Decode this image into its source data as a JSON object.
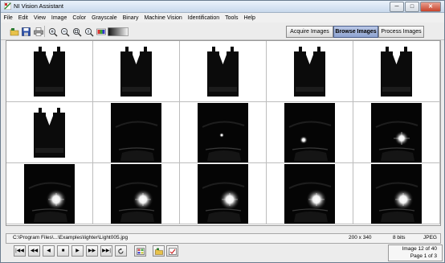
{
  "window": {
    "title": "NI Vision Assistant",
    "minimize": "─",
    "maximize": "□",
    "close": "✕"
  },
  "menu": [
    "File",
    "Edit",
    "View",
    "Image",
    "Color",
    "Grayscale",
    "Binary",
    "Machine Vision",
    "Identification",
    "Tools",
    "Help"
  ],
  "modes": {
    "acquire": "Acquire Images",
    "browse": "Browse Images",
    "process": "Process Images"
  },
  "thumbnails": [
    {
      "kind": "binary"
    },
    {
      "kind": "binary"
    },
    {
      "kind": "binary"
    },
    {
      "kind": "binary"
    },
    {
      "kind": "binary"
    },
    {
      "kind": "binary"
    },
    {
      "kind": "dark",
      "level": 0
    },
    {
      "kind": "dark",
      "level": 1
    },
    {
      "kind": "dark",
      "level": 2
    },
    {
      "kind": "dark",
      "level": 3
    },
    {
      "kind": "dark",
      "level": 4
    },
    {
      "kind": "dark",
      "level": 4
    },
    {
      "kind": "dark",
      "level": 4
    },
    {
      "kind": "dark",
      "level": 4
    },
    {
      "kind": "dark",
      "level": 4
    }
  ],
  "status": {
    "path": "C:\\Program Files\\...\\Examples\\lighter\\Light005.jpg",
    "dimensions": "200 x 340",
    "depth": "8 bits",
    "format": "JPEG"
  },
  "navigation": {
    "first": "|◀◀",
    "prev_fast": "◀◀",
    "prev": "◀",
    "stop": "■",
    "next": "▶",
    "next_fast": "▶▶",
    "last": "▶▶|"
  },
  "image_info": {
    "image": "Image  12 of 40",
    "page": "Page  1 of 3"
  }
}
